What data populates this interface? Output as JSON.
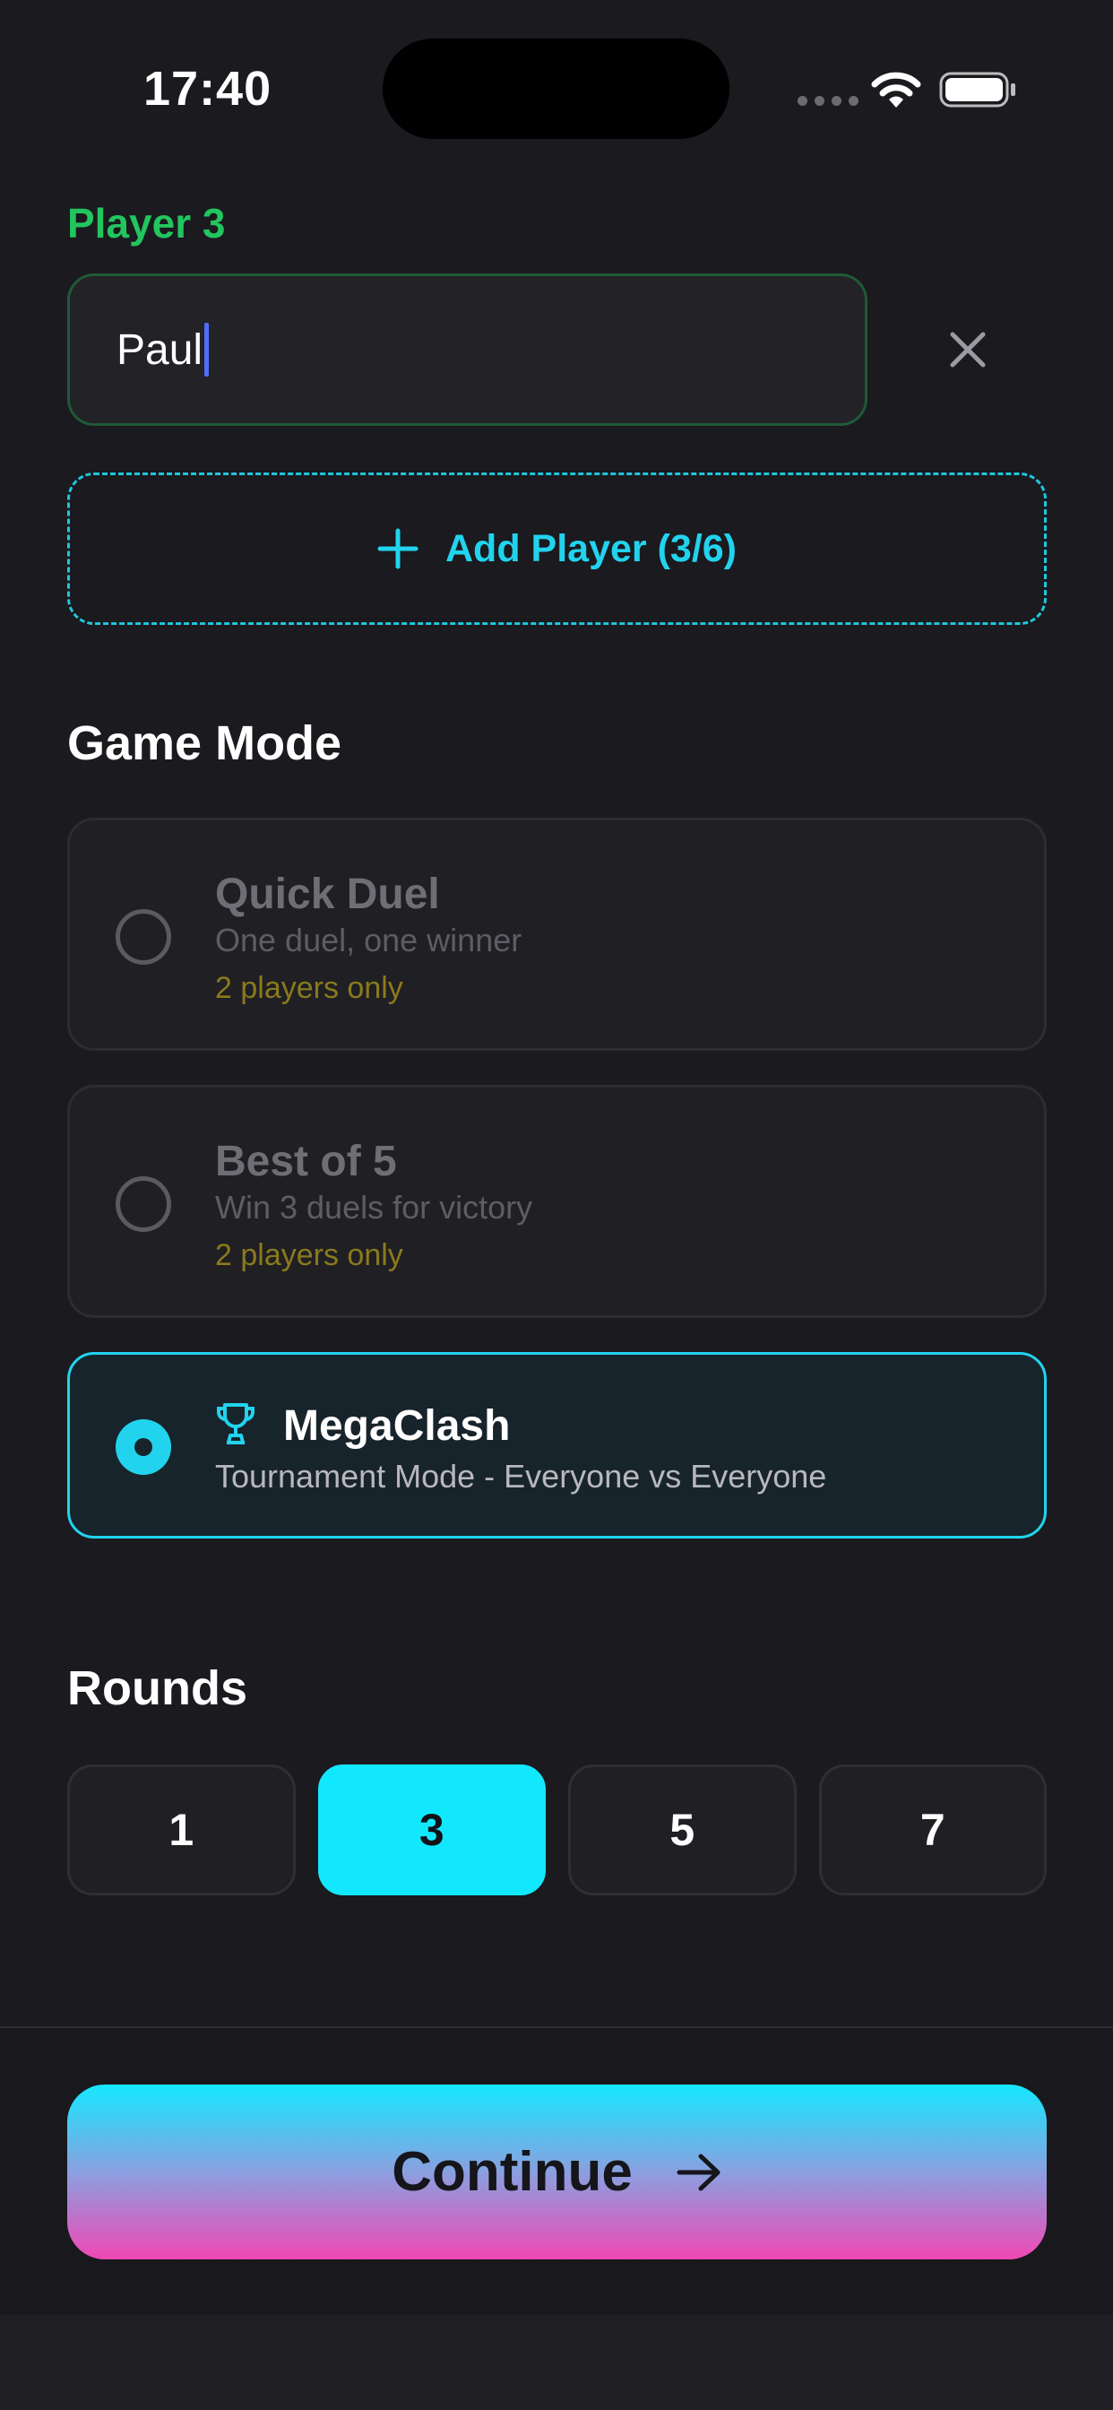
{
  "status_bar": {
    "time": "17:40"
  },
  "player": {
    "label": "Player 3",
    "name_value": "Paul"
  },
  "add_player": {
    "label": "Add Player (3/6)"
  },
  "game_mode": {
    "title": "Game Mode",
    "modes": [
      {
        "title": "Quick Duel",
        "subtitle": "One duel, one winner",
        "note": "2 players only",
        "selected": false
      },
      {
        "title": "Best of 5",
        "subtitle": "Win 3 duels for victory",
        "note": "2 players only",
        "selected": false
      },
      {
        "title": "MegaClash",
        "subtitle": "Tournament Mode - Everyone vs Everyone",
        "icon": "trophy-icon",
        "selected": true
      }
    ]
  },
  "rounds": {
    "title": "Rounds",
    "options": [
      "1",
      "3",
      "5",
      "7"
    ],
    "selected": "3"
  },
  "continue": {
    "label": "Continue",
    "icon": "arrow-right-icon"
  },
  "colors": {
    "accent_cyan": "#22d3ee",
    "accent_green": "#22c55e",
    "note_gold": "#8a7a1c",
    "gradient_top": "#15e8ff",
    "gradient_bottom": "#f048b5",
    "background": "#1a1a1f"
  }
}
